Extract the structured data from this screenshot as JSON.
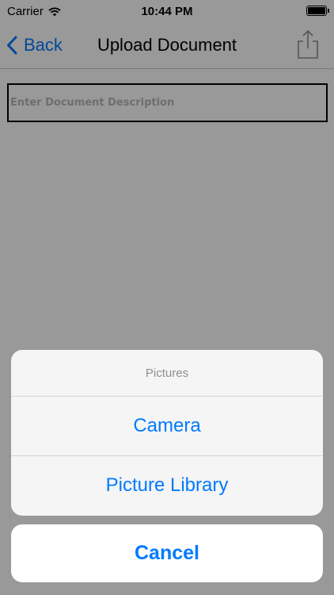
{
  "status_bar": {
    "carrier": "Carrier",
    "time": "10:44 PM",
    "icons": [
      "wifi-icon",
      "battery-icon"
    ]
  },
  "nav": {
    "back_label": "Back",
    "title": "Upload Document",
    "icons": [
      "chevron-left-icon",
      "share-icon"
    ]
  },
  "form": {
    "description_placeholder": "Enter Document Description",
    "description_value": ""
  },
  "action_sheet": {
    "title": "Pictures",
    "items": [
      {
        "label": "Camera"
      },
      {
        "label": "Picture Library"
      }
    ],
    "cancel_label": "Cancel"
  },
  "colors": {
    "accent": "#007aff",
    "overlay": "rgba(0,0,0,0.40)",
    "sheet_background": "#f8f8f8",
    "sheet_title": "#8f8f8f"
  }
}
